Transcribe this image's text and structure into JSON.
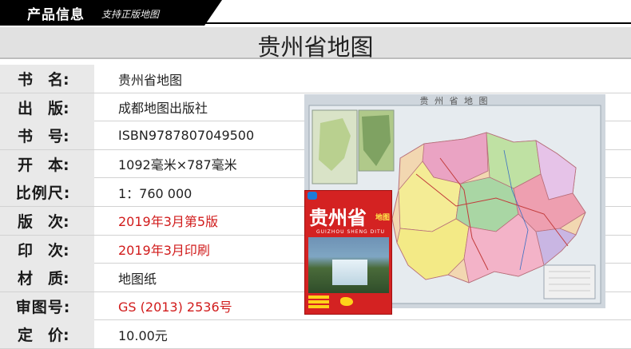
{
  "header": {
    "tab_title": "产品信息",
    "tab_subtitle": "支持正版地图"
  },
  "title_band": "贵州省地图",
  "rows": [
    {
      "label": "书　名:",
      "value": "贵州省地图",
      "red": false
    },
    {
      "label": "出　版:",
      "value": "成都地图出版社",
      "red": false
    },
    {
      "label": "书　号:",
      "value": "ISBN9787807049500",
      "red": false
    },
    {
      "label": "开　本:",
      "value": "1092毫米×787毫米",
      "red": false
    },
    {
      "label": "比例尺:",
      "value": "1：760 000",
      "red": false
    },
    {
      "label": "版　次:",
      "value": "2019年3月第5版",
      "red": true
    },
    {
      "label": "印　次:",
      "value": "2019年3月印刷",
      "red": true
    },
    {
      "label": "材　质:",
      "value": "地图纸",
      "red": false
    },
    {
      "label": "审图号:",
      "value": "GS (2013) 2536号",
      "red": true
    },
    {
      "label": "定　价:",
      "value": "10.00元",
      "red": false
    }
  ],
  "map": {
    "title": "贵  州  省  地  图"
  },
  "cover": {
    "title": "贵州省",
    "title_small": "地图",
    "pinyin": "GUIZHOU SHENG DITU"
  }
}
